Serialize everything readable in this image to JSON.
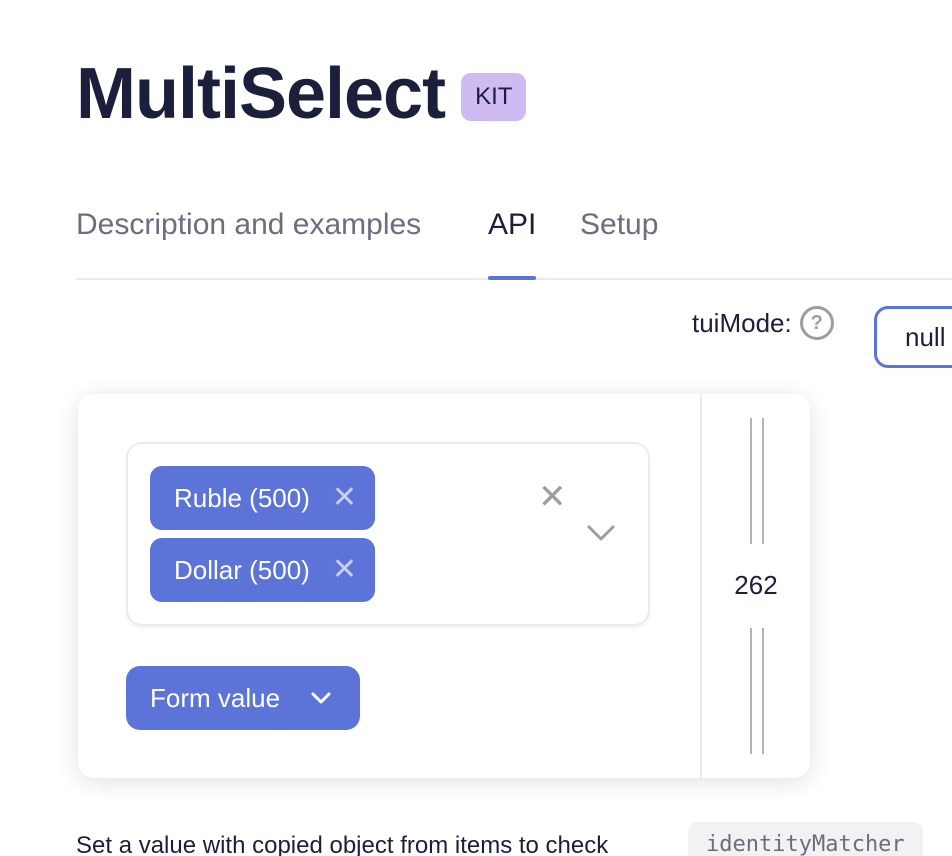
{
  "header": {
    "title": "MultiSelect",
    "badge": "KIT"
  },
  "tabs": [
    {
      "label": "Description and examples",
      "active": false
    },
    {
      "label": "API",
      "active": true
    },
    {
      "label": "Setup",
      "active": false
    }
  ],
  "mode": {
    "label": "tuiMode:",
    "value": "null"
  },
  "demo": {
    "chips": [
      {
        "label": "Ruble (500)"
      },
      {
        "label": "Dollar (500)"
      }
    ],
    "width_readout": "262",
    "form_value_label": "Form value"
  },
  "description": {
    "text": "Set a value with copied object from items to check",
    "code": "identityMatcher"
  },
  "colors": {
    "accent": "#5c73d8",
    "badge": "#cdbbf2",
    "text": "#1b1f3b"
  }
}
